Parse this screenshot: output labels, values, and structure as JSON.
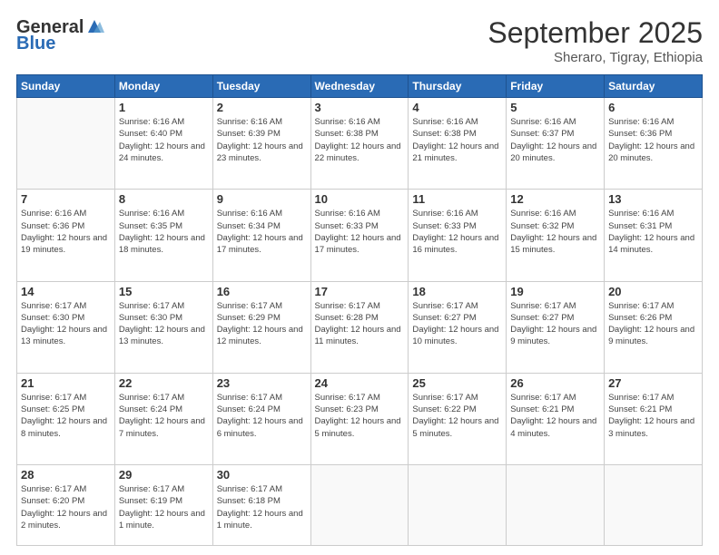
{
  "header": {
    "logo_general": "General",
    "logo_blue": "Blue",
    "month": "September 2025",
    "location": "Sheraro, Tigray, Ethiopia"
  },
  "days_of_week": [
    "Sunday",
    "Monday",
    "Tuesday",
    "Wednesday",
    "Thursday",
    "Friday",
    "Saturday"
  ],
  "weeks": [
    [
      {
        "day": "",
        "info": ""
      },
      {
        "day": "1",
        "info": "Sunrise: 6:16 AM\nSunset: 6:40 PM\nDaylight: 12 hours and 24 minutes."
      },
      {
        "day": "2",
        "info": "Sunrise: 6:16 AM\nSunset: 6:39 PM\nDaylight: 12 hours and 23 minutes."
      },
      {
        "day": "3",
        "info": "Sunrise: 6:16 AM\nSunset: 6:38 PM\nDaylight: 12 hours and 22 minutes."
      },
      {
        "day": "4",
        "info": "Sunrise: 6:16 AM\nSunset: 6:38 PM\nDaylight: 12 hours and 21 minutes."
      },
      {
        "day": "5",
        "info": "Sunrise: 6:16 AM\nSunset: 6:37 PM\nDaylight: 12 hours and 20 minutes."
      },
      {
        "day": "6",
        "info": "Sunrise: 6:16 AM\nSunset: 6:36 PM\nDaylight: 12 hours and 20 minutes."
      }
    ],
    [
      {
        "day": "7",
        "info": "Sunrise: 6:16 AM\nSunset: 6:36 PM\nDaylight: 12 hours and 19 minutes."
      },
      {
        "day": "8",
        "info": "Sunrise: 6:16 AM\nSunset: 6:35 PM\nDaylight: 12 hours and 18 minutes."
      },
      {
        "day": "9",
        "info": "Sunrise: 6:16 AM\nSunset: 6:34 PM\nDaylight: 12 hours and 17 minutes."
      },
      {
        "day": "10",
        "info": "Sunrise: 6:16 AM\nSunset: 6:33 PM\nDaylight: 12 hours and 17 minutes."
      },
      {
        "day": "11",
        "info": "Sunrise: 6:16 AM\nSunset: 6:33 PM\nDaylight: 12 hours and 16 minutes."
      },
      {
        "day": "12",
        "info": "Sunrise: 6:16 AM\nSunset: 6:32 PM\nDaylight: 12 hours and 15 minutes."
      },
      {
        "day": "13",
        "info": "Sunrise: 6:16 AM\nSunset: 6:31 PM\nDaylight: 12 hours and 14 minutes."
      }
    ],
    [
      {
        "day": "14",
        "info": "Sunrise: 6:17 AM\nSunset: 6:30 PM\nDaylight: 12 hours and 13 minutes."
      },
      {
        "day": "15",
        "info": "Sunrise: 6:17 AM\nSunset: 6:30 PM\nDaylight: 12 hours and 13 minutes."
      },
      {
        "day": "16",
        "info": "Sunrise: 6:17 AM\nSunset: 6:29 PM\nDaylight: 12 hours and 12 minutes."
      },
      {
        "day": "17",
        "info": "Sunrise: 6:17 AM\nSunset: 6:28 PM\nDaylight: 12 hours and 11 minutes."
      },
      {
        "day": "18",
        "info": "Sunrise: 6:17 AM\nSunset: 6:27 PM\nDaylight: 12 hours and 10 minutes."
      },
      {
        "day": "19",
        "info": "Sunrise: 6:17 AM\nSunset: 6:27 PM\nDaylight: 12 hours and 9 minutes."
      },
      {
        "day": "20",
        "info": "Sunrise: 6:17 AM\nSunset: 6:26 PM\nDaylight: 12 hours and 9 minutes."
      }
    ],
    [
      {
        "day": "21",
        "info": "Sunrise: 6:17 AM\nSunset: 6:25 PM\nDaylight: 12 hours and 8 minutes."
      },
      {
        "day": "22",
        "info": "Sunrise: 6:17 AM\nSunset: 6:24 PM\nDaylight: 12 hours and 7 minutes."
      },
      {
        "day": "23",
        "info": "Sunrise: 6:17 AM\nSunset: 6:24 PM\nDaylight: 12 hours and 6 minutes."
      },
      {
        "day": "24",
        "info": "Sunrise: 6:17 AM\nSunset: 6:23 PM\nDaylight: 12 hours and 5 minutes."
      },
      {
        "day": "25",
        "info": "Sunrise: 6:17 AM\nSunset: 6:22 PM\nDaylight: 12 hours and 5 minutes."
      },
      {
        "day": "26",
        "info": "Sunrise: 6:17 AM\nSunset: 6:21 PM\nDaylight: 12 hours and 4 minutes."
      },
      {
        "day": "27",
        "info": "Sunrise: 6:17 AM\nSunset: 6:21 PM\nDaylight: 12 hours and 3 minutes."
      }
    ],
    [
      {
        "day": "28",
        "info": "Sunrise: 6:17 AM\nSunset: 6:20 PM\nDaylight: 12 hours and 2 minutes."
      },
      {
        "day": "29",
        "info": "Sunrise: 6:17 AM\nSunset: 6:19 PM\nDaylight: 12 hours and 1 minute."
      },
      {
        "day": "30",
        "info": "Sunrise: 6:17 AM\nSunset: 6:18 PM\nDaylight: 12 hours and 1 minute."
      },
      {
        "day": "",
        "info": ""
      },
      {
        "day": "",
        "info": ""
      },
      {
        "day": "",
        "info": ""
      },
      {
        "day": "",
        "info": ""
      }
    ]
  ]
}
